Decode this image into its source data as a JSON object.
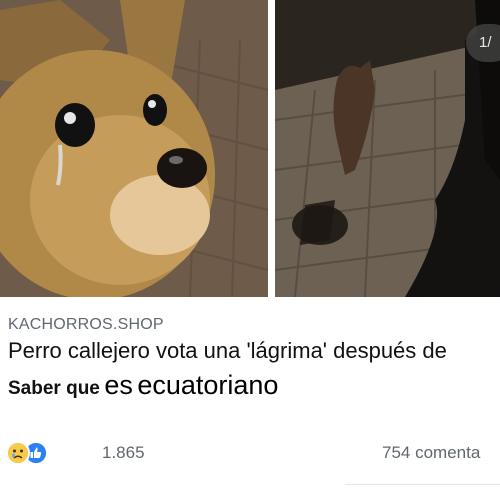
{
  "post": {
    "image_counter": "1/",
    "source": "KACHORROS.SHOP",
    "headline": "Perro callejero vota una 'lágrima' después de",
    "caption_small": "Saber que",
    "caption_mid": "es",
    "caption_big": "ecuatoriano"
  },
  "engagement": {
    "reaction_icons": [
      "sad-face-icon",
      "thumbs-up-icon"
    ],
    "reaction_count": "1.865",
    "comment_count": "754 comenta"
  },
  "colors": {
    "like_blue": "#2e7ff2",
    "sad_yellow": "#f7c94c",
    "muted_text": "#606770"
  }
}
